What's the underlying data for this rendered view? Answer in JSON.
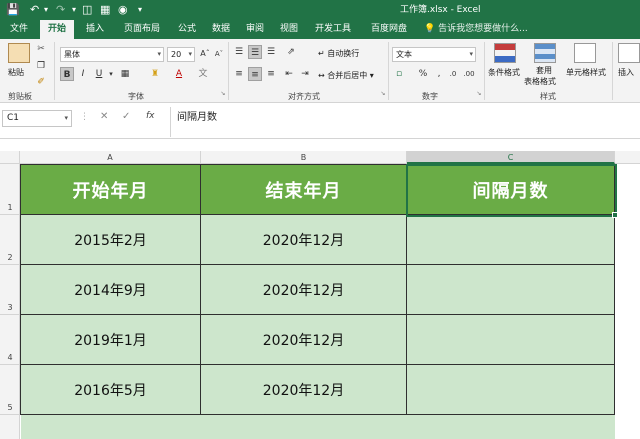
{
  "window": {
    "title": "工作簿.xlsx - Excel",
    "accent": "#217346"
  },
  "ribbon_tabs": [
    "文件",
    "开始",
    "插入",
    "页面布局",
    "公式",
    "数据",
    "审阅",
    "视图",
    "开发工具",
    "百度网盘"
  ],
  "active_tab": "开始",
  "tell_me": "告诉我您想要做什么...",
  "clipboard": {
    "paste": "粘贴",
    "label": "剪贴板"
  },
  "font": {
    "name": "黑体",
    "size": "20",
    "label": "字体"
  },
  "alignment": {
    "wrap": "自动换行",
    "merge": "合并后居中",
    "label": "对齐方式"
  },
  "number": {
    "format": "文本",
    "label": "数字"
  },
  "styles": {
    "conditional": "条件格式",
    "table_line1": "套用",
    "table_line2": "表格格式",
    "cell_styles": "单元格样式",
    "label": "样式"
  },
  "cells": {
    "insert": "插入"
  },
  "formula_bar": {
    "name_box": "C1",
    "fx": "fx",
    "content": "间隔月数"
  },
  "sheet": {
    "columns": [
      "A",
      "B",
      "C"
    ],
    "rows": [
      "1",
      "2",
      "3",
      "4",
      "5"
    ],
    "header": [
      "开始年月",
      "结束年月",
      "间隔月数"
    ],
    "data": [
      [
        "2015年2月",
        "2020年12月",
        ""
      ],
      [
        "2014年9月",
        "2020年12月",
        ""
      ],
      [
        "2019年1月",
        "2020年12月",
        ""
      ],
      [
        "2016年5月",
        "2020年12月",
        ""
      ]
    ],
    "selected_cell": "C1",
    "header_fill": "#6aac46",
    "body_fill": "#cde6cc"
  }
}
